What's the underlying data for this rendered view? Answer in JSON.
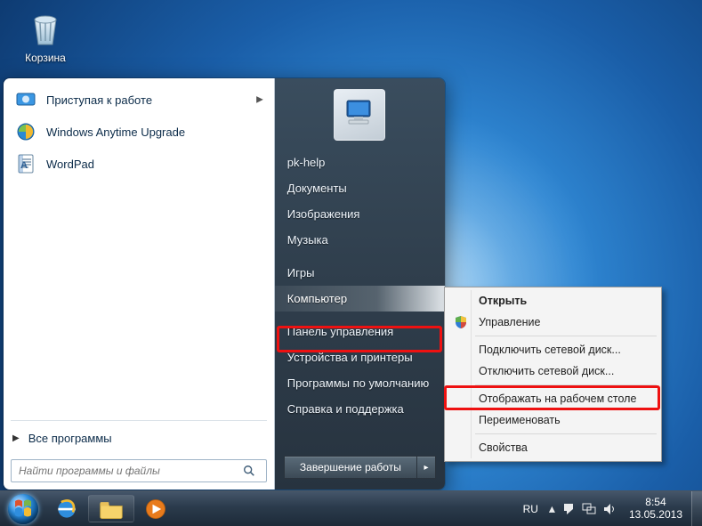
{
  "desktop": {
    "recycle_bin_label": "Корзина"
  },
  "start_menu": {
    "left": {
      "items": [
        {
          "label": "Приступая к работе",
          "has_submenu": true
        },
        {
          "label": "Windows Anytime Upgrade",
          "has_submenu": false
        },
        {
          "label": "WordPad",
          "has_submenu": false
        }
      ],
      "all_programs_label": "Все программы",
      "search_placeholder": "Найти программы и файлы"
    },
    "right": {
      "items": [
        "pk-help",
        "Документы",
        "Изображения",
        "Музыка",
        "Игры",
        "Компьютер",
        "Панель управления",
        "Устройства и принтеры",
        "Программы по умолчанию",
        "Справка и поддержка"
      ],
      "selected_index": 5,
      "shutdown_label": "Завершение работы"
    }
  },
  "context_menu": {
    "items": [
      {
        "label": "Открыть",
        "bold": true
      },
      {
        "label": "Управление",
        "icon": "shield"
      },
      {
        "sep": true
      },
      {
        "label": "Подключить сетевой диск..."
      },
      {
        "label": "Отключить сетевой диск..."
      },
      {
        "sep": true
      },
      {
        "label": "Отображать на рабочем столе",
        "highlight": true
      },
      {
        "label": "Переименовать"
      },
      {
        "sep": true
      },
      {
        "label": "Свойства"
      }
    ]
  },
  "taskbar": {
    "lang": "RU",
    "time": "8:54",
    "date": "13.05.2013"
  }
}
